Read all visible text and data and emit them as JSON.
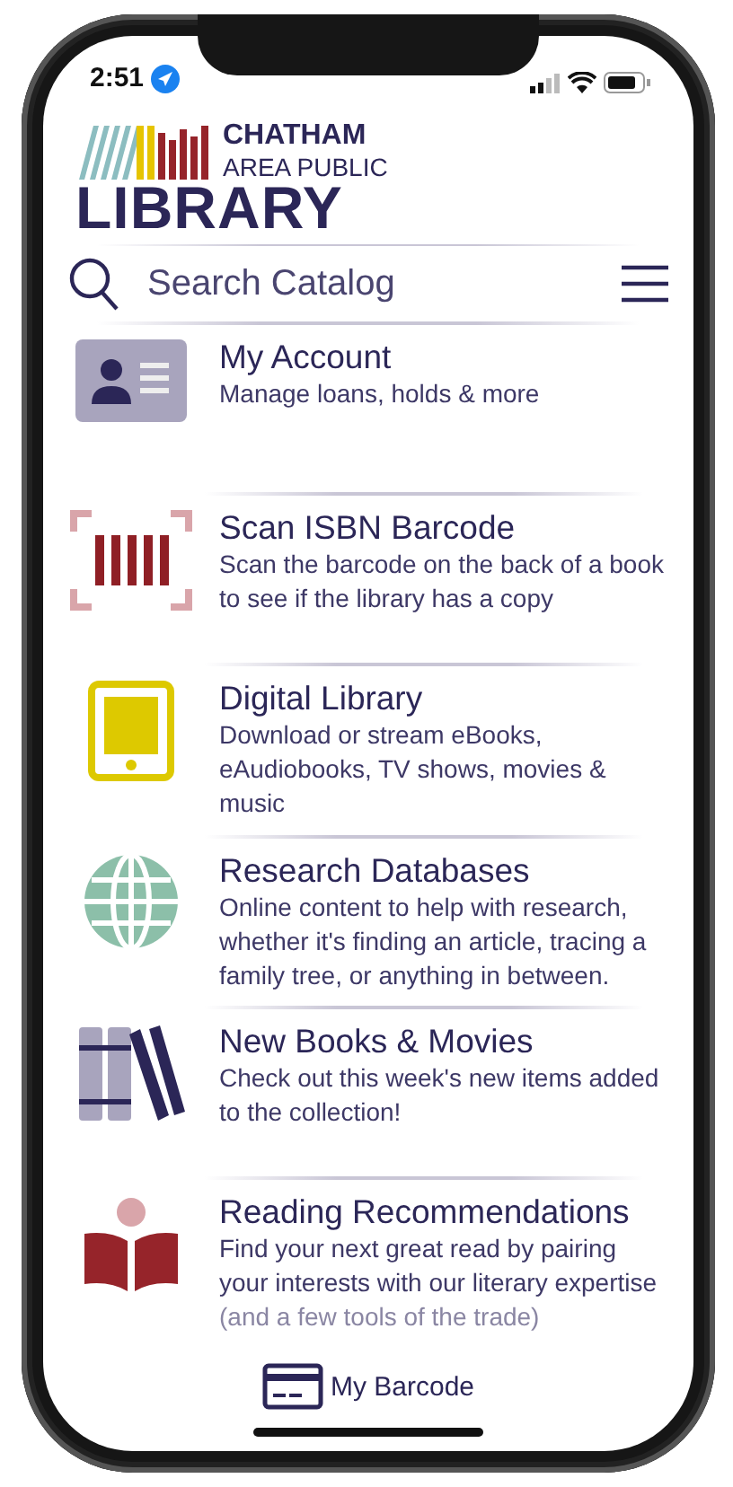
{
  "status_bar": {
    "time": "2:51"
  },
  "logo": {
    "line_1": "CHATHAM",
    "line_2": "AREA PUBLIC",
    "line_3": "LIBRARY"
  },
  "search": {
    "placeholder": "Search Catalog"
  },
  "menu_items": [
    {
      "kind": "account",
      "title": "My Account",
      "description": "Manage loans, holds & more"
    },
    {
      "kind": "barcode",
      "title": "Scan ISBN Barcode",
      "description": "Scan the barcode on the back of a book to see if the library has a copy"
    },
    {
      "kind": "tablet",
      "title": "Digital Library",
      "description": "Download or stream eBooks, eAudiobooks, TV shows, movies & music"
    },
    {
      "kind": "globe",
      "title": "Research Databases",
      "description": "Online content to help with research, whether it's finding an article, tracing a family tree, or anything in between."
    },
    {
      "kind": "books",
      "title": "New Books & Movies",
      "description": "Check out this week's new items added to the collection!"
    },
    {
      "kind": "reader",
      "title": "Reading Recommendations",
      "description": "Find your next great read by pairing your interests with our literary expertise",
      "faded_line": "(and a few tools of the trade)"
    }
  ],
  "bottom_bar": {
    "label": "My Barcode"
  }
}
